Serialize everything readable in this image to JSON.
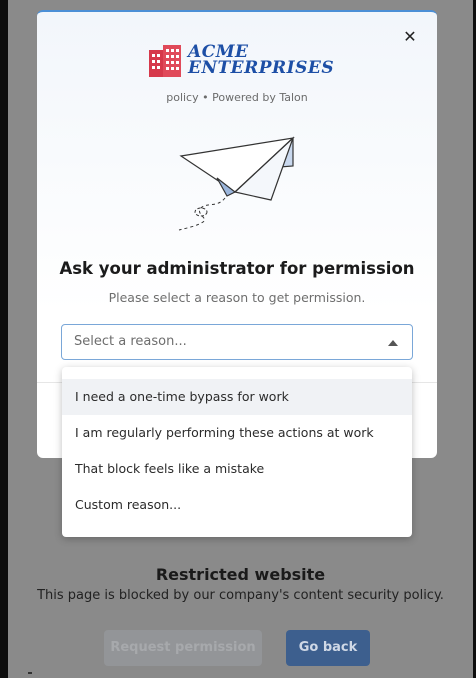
{
  "background_page": {
    "title": "Restricted website",
    "subtitle": "This page is blocked by our company's content security policy.",
    "request_button": "Request permission",
    "back_button": "Go back"
  },
  "modal": {
    "logo": {
      "line1": "ACME",
      "line2": "ENTERPRISES"
    },
    "powered_by": "policy • Powered by Talon",
    "title": "Ask your administrator for permission",
    "subtitle": "Please select a reason to get permission.",
    "close_icon": "close-icon",
    "illustration": "paper-plane-icon",
    "select": {
      "placeholder": "Select a reason..."
    }
  },
  "dropdown": {
    "options": [
      {
        "label": "I need a one-time bypass for work",
        "highlighted": true
      },
      {
        "label": "I am regularly performing these actions at work"
      },
      {
        "label": "That block feels like a mistake"
      },
      {
        "label": "Custom reason..."
      }
    ]
  },
  "colors": {
    "accent": "#4b8fd6",
    "brand": "#1d4fa6",
    "logo_building": "#d6394b",
    "go_back": "#3d5f8e"
  }
}
